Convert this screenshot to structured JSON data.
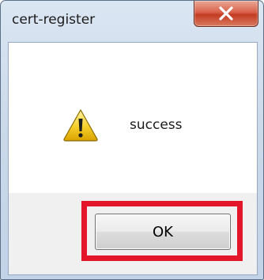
{
  "window": {
    "title": "cert-register"
  },
  "dialog": {
    "icon": "warning-icon",
    "message": "success"
  },
  "buttons": {
    "ok_label": "OK",
    "close_icon": "close-icon"
  },
  "annotation": {
    "highlight_color": "#e3162a"
  }
}
